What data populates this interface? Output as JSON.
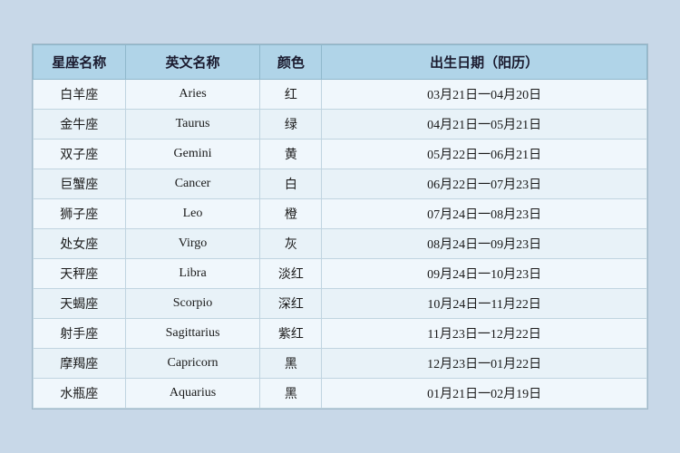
{
  "table": {
    "headers": {
      "name": "星座名称",
      "english": "英文名称",
      "color": "颜色",
      "date": "出生日期（阳历）"
    },
    "rows": [
      {
        "name": "白羊座",
        "english": "Aries",
        "color": "红",
        "date": "03月21日一04月20日"
      },
      {
        "name": "金牛座",
        "english": "Taurus",
        "color": "绿",
        "date": "04月21日一05月21日"
      },
      {
        "name": "双子座",
        "english": "Gemini",
        "color": "黄",
        "date": "05月22日一06月21日"
      },
      {
        "name": "巨蟹座",
        "english": "Cancer",
        "color": "白",
        "date": "06月22日一07月23日"
      },
      {
        "name": "狮子座",
        "english": "Leo",
        "color": "橙",
        "date": "07月24日一08月23日"
      },
      {
        "name": "处女座",
        "english": "Virgo",
        "color": "灰",
        "date": "08月24日一09月23日"
      },
      {
        "name": "天秤座",
        "english": "Libra",
        "color": "淡红",
        "date": "09月24日一10月23日"
      },
      {
        "name": "天蝎座",
        "english": "Scorpio",
        "color": "深红",
        "date": "10月24日一11月22日"
      },
      {
        "name": "射手座",
        "english": "Sagittarius",
        "color": "紫红",
        "date": "11月23日一12月22日"
      },
      {
        "name": "摩羯座",
        "english": "Capricorn",
        "color": "黑",
        "date": "12月23日一01月22日"
      },
      {
        "name": "水瓶座",
        "english": "Aquarius",
        "color": "黑",
        "date": "01月21日一02月19日"
      }
    ]
  }
}
